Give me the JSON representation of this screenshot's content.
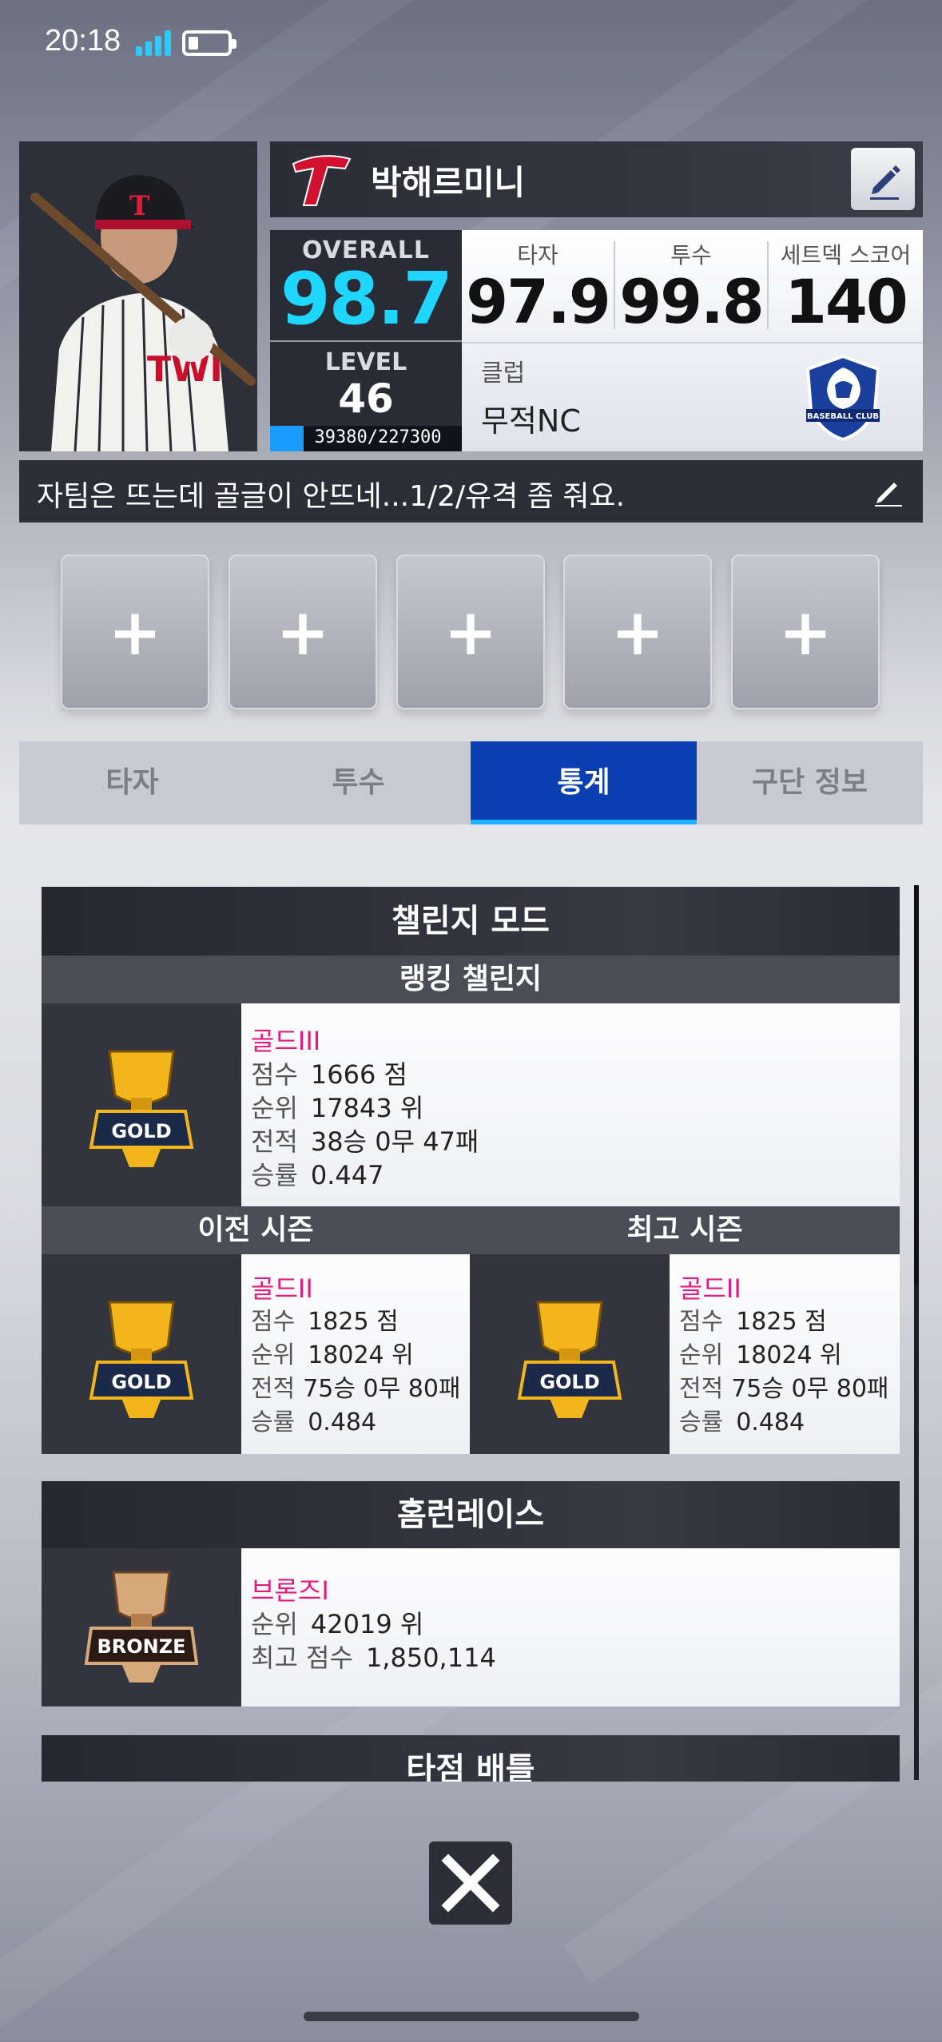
{
  "status_bar": {
    "time": "20:18",
    "battery_level": 0.25
  },
  "profile": {
    "name": "박해르미니",
    "overall_label": "OVERALL",
    "overall_value": "98.7",
    "level_label": "LEVEL",
    "level_value": "46",
    "exp_text": "39380/227300",
    "exp_fraction": 0.173,
    "scores": [
      {
        "label": "타자",
        "value": "97.9"
      },
      {
        "label": "투수",
        "value": "99.8"
      },
      {
        "label": "세트덱 스코어",
        "value": "140"
      }
    ],
    "club_label": "클럽",
    "club_name": "무적NC",
    "club_logo_text": "BASEBALL CLUB"
  },
  "motto": "자팀은 뜨는데 골글이 안뜨네...1/2/유격 좀 줘요.",
  "slots": [
    "+",
    "+",
    "+",
    "+",
    "+"
  ],
  "tabs": [
    {
      "label": "타자",
      "active": false
    },
    {
      "label": "투수",
      "active": false
    },
    {
      "label": "통계",
      "active": true
    },
    {
      "label": "구단 정보",
      "active": false
    }
  ],
  "challenge": {
    "title": "챌린지 모드",
    "ranking_title": "랭킹 챌린지",
    "current": {
      "tier": "골드III",
      "badge": "GOLD",
      "rows": [
        {
          "k": "점수",
          "v": "1666 점"
        },
        {
          "k": "순위",
          "v": "17843 위"
        },
        {
          "k": "전적",
          "v": "38승 0무 47패"
        },
        {
          "k": "승률",
          "v": "0.447"
        }
      ]
    },
    "prev_title": "이전 시즌",
    "best_title": "최고 시즌",
    "prev": {
      "tier": "골드II",
      "badge": "GOLD",
      "rows": [
        {
          "k": "점수",
          "v": "1825 점"
        },
        {
          "k": "순위",
          "v": "18024 위"
        },
        {
          "k": "전적",
          "v": "75승 0무 80패"
        },
        {
          "k": "승률",
          "v": "0.484"
        }
      ]
    },
    "best": {
      "tier": "골드II",
      "badge": "GOLD",
      "rows": [
        {
          "k": "점수",
          "v": "1825 점"
        },
        {
          "k": "순위",
          "v": "18024 위"
        },
        {
          "k": "전적",
          "v": "75승 0무 80패"
        },
        {
          "k": "승률",
          "v": "0.484"
        }
      ]
    }
  },
  "homerun": {
    "title": "홈런레이스",
    "tier": "브론즈I",
    "badge": "BRONZE",
    "rows": [
      {
        "k": "순위",
        "v": "42019 위"
      },
      {
        "k": "최고 점수",
        "v": "1,850,114"
      }
    ]
  },
  "rbi_battle": {
    "title": "타점 배틀"
  },
  "colors": {
    "accent_cyan": "#1ed6ff",
    "tab_active": "#0b3fb1",
    "tier_pink": "#e5187c",
    "header_dark": "#2b2d36"
  }
}
